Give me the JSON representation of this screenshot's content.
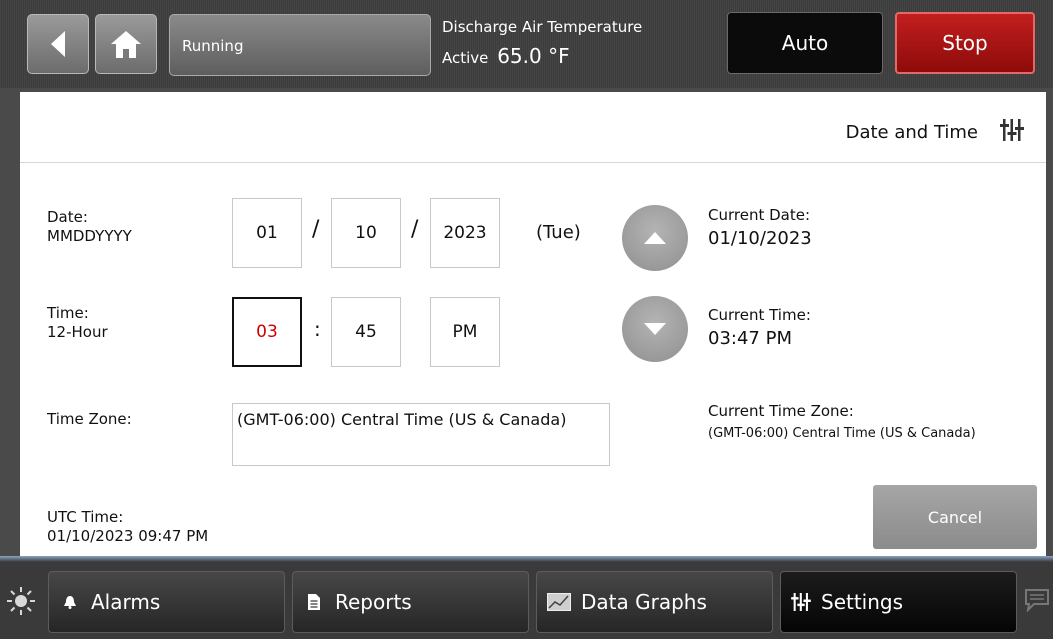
{
  "header": {
    "status": "Running",
    "temp_title": "Discharge Air Temperature",
    "temp_prefix": "Active",
    "temp_value": "65.0 °F",
    "auto_label": "Auto",
    "stop_label": "Stop"
  },
  "page": {
    "title": "Date and Time"
  },
  "form": {
    "date_label": "Date:",
    "date_format": "MMDDYYYY",
    "month": "01",
    "day": "10",
    "year": "2023",
    "date_sep": "/",
    "weekday": "(Tue)",
    "time_label": "Time:",
    "time_format": "12-Hour",
    "hour": "03",
    "time_sep": ":",
    "minute": "45",
    "ampm": "PM",
    "tz_label": "Time Zone:",
    "tz_value": "(GMT-06:00) Central Time (US & Canada)",
    "utc_label": "UTC Time:",
    "utc_value": "01/10/2023 09:47 PM"
  },
  "current": {
    "date_label": "Current Date:",
    "date_value": "01/10/2023",
    "time_label": "Current Time:",
    "time_value": "03:47 PM",
    "tz_label": "Current Time Zone:",
    "tz_value": "(GMT-06:00) Central Time (US & Canada)"
  },
  "actions": {
    "cancel_label": "Cancel"
  },
  "nav": {
    "alarms": "Alarms",
    "reports": "Reports",
    "data_graphs": "Data Graphs",
    "settings": "Settings"
  },
  "colors": {
    "stop": "#b01515",
    "selected_text": "#cc0000",
    "panel": "#ffffff"
  }
}
